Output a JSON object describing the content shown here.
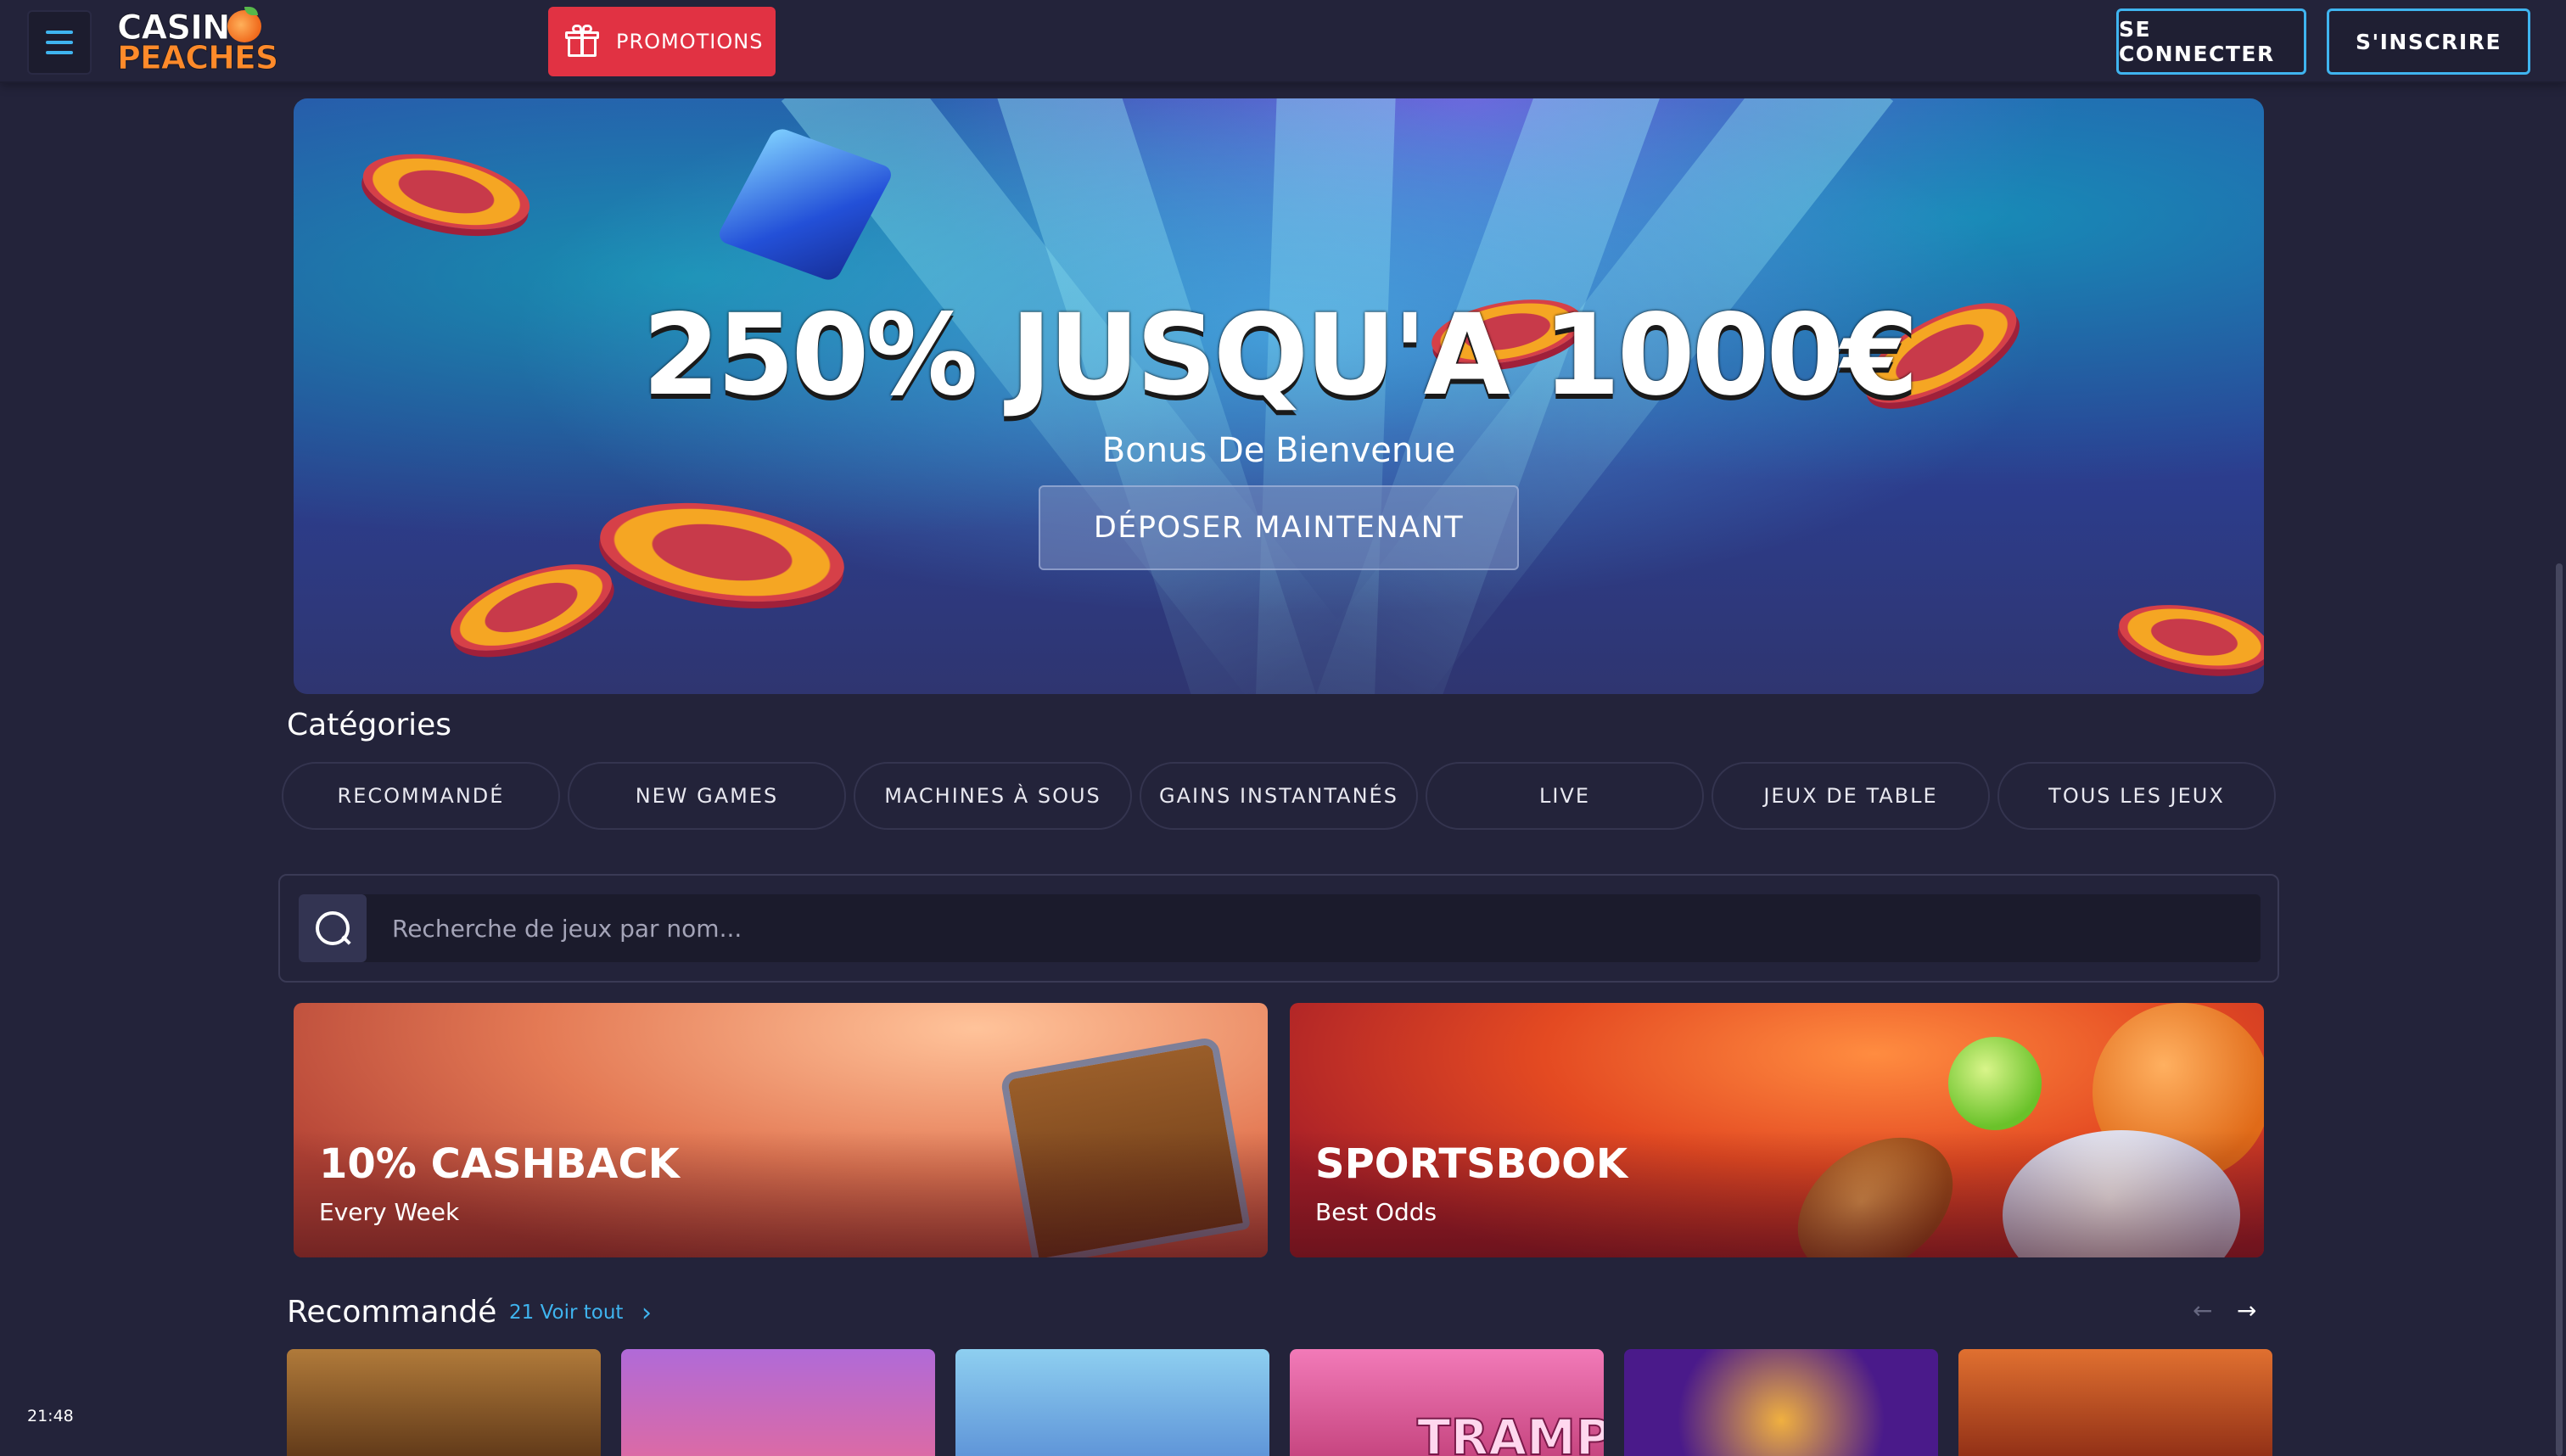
{
  "header": {
    "logo_line1": "CASINO",
    "logo_line2": "PEACHES",
    "promotions_label": "PROMOTIONS",
    "login_label": "SE CONNECTER",
    "signup_label": "S'INSCRIRE"
  },
  "hero": {
    "title": "250% JUSQU'A 1000€",
    "subtitle": "Bonus De Bienvenue",
    "cta_label": "DÉPOSER MAINTENANT"
  },
  "categories": {
    "title": "Catégories",
    "items": [
      {
        "label": "RECOMMANDÉ"
      },
      {
        "label": "NEW GAMES"
      },
      {
        "label": "MACHINES À SOUS"
      },
      {
        "label": "GAINS INSTANTANÉS"
      },
      {
        "label": "LIVE"
      },
      {
        "label": "JEUX DE TABLE"
      },
      {
        "label": "TOUS LES JEUX"
      }
    ]
  },
  "search": {
    "placeholder": "Recherche de jeux par nom...",
    "value": ""
  },
  "promo_cards": [
    {
      "title": "10% CASHBACK",
      "subtitle": "Every Week"
    },
    {
      "title": "SPORTSBOOK",
      "subtitle": "Best Odds"
    }
  ],
  "recommended": {
    "title": "Recommandé",
    "see_all": "21 Voir tout",
    "tiles": [
      {
        "theme": "anubis",
        "color": "#8a5a2a"
      },
      {
        "theme": "candy-egg",
        "color": "#c75fc9"
      },
      {
        "theme": "angel",
        "color": "#6fb6e8"
      },
      {
        "theme": "tramp",
        "color": "#e05a9a",
        "text": "TRAMP"
      },
      {
        "theme": "golden-dragon",
        "color": "#5a2aa0"
      },
      {
        "theme": "spartan",
        "color": "#c0431e"
      }
    ]
  },
  "icons": {
    "menu": "hamburger-icon",
    "promotions": "gift-icon",
    "search": "search-icon",
    "see_all": "chevron-right-icon",
    "prev": "arrow-left-icon",
    "next": "arrow-right-icon"
  },
  "colors": {
    "background": "#23233a",
    "accent": "#3fb4ef",
    "promotions": "#e13243"
  },
  "status": {
    "clock": "21:48"
  }
}
